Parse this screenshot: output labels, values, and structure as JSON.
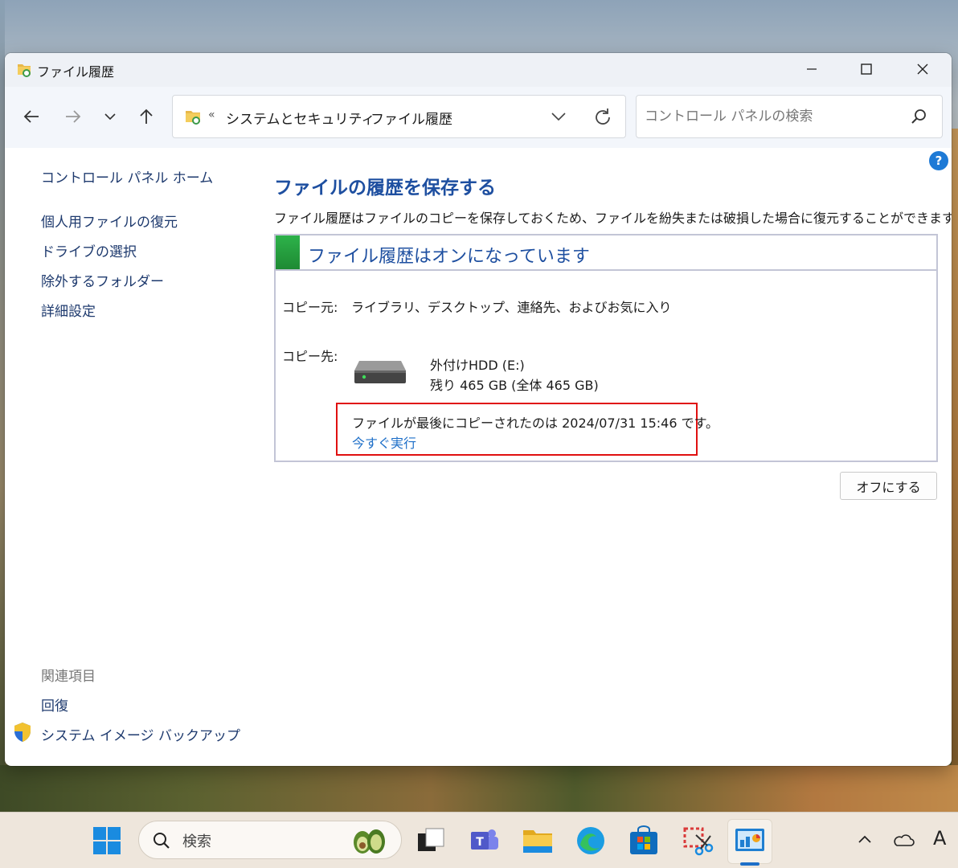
{
  "window": {
    "title": "ファイル履歴"
  },
  "navigation": {
    "breadcrumb_overflow": "«",
    "breadcrumb_separator": "›",
    "breadcrumbs": [
      "システムとセキュリティ",
      "ファイル履歴"
    ],
    "search_placeholder": "コントロール パネルの検索"
  },
  "sidebar": {
    "home": "コントロール パネル ホーム",
    "items": [
      "個人用ファイルの復元",
      "ドライブの選択",
      "除外するフォルダー",
      "詳細設定"
    ],
    "related_heading": "関連項目",
    "related_items": [
      "回復",
      "システム イメージ バックアップ"
    ]
  },
  "main": {
    "title": "ファイルの履歴を保存する",
    "description": "ファイル履歴はファイルのコピーを保存しておくため、ファイルを紛失または破損した場合に復元することができます。",
    "status_title": "ファイル履歴はオンになっています",
    "source_label": "コピー元:",
    "source_value": "ライブラリ、デスクトップ、連絡先、およびお気に入り",
    "dest_label": "コピー先:",
    "drive_name": "外付けHDD (E:)",
    "drive_space": "残り 465 GB (全体 465 GB)",
    "last_copy": "ファイルが最後にコピーされたのは 2024/07/31 15:46 です。",
    "run_now": "今すぐ実行",
    "off_button": "オフにする"
  },
  "taskbar": {
    "search_label": "検索",
    "tray_ime": "A"
  },
  "colors": {
    "link_blue": "#1e4fa0",
    "highlight_red": "#e01010",
    "status_green": "#2db24a"
  }
}
